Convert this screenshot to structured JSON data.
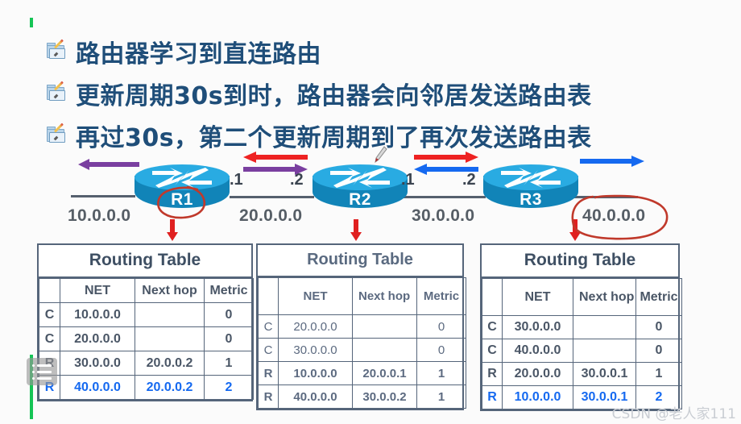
{
  "slide": {
    "bullets": [
      {
        "icon": "folder-pencil-icon",
        "text": "路由器学习到直连路由"
      },
      {
        "icon": "folder-pencil-icon",
        "text": "更新周期30s到时，路由器会向邻居发送路由表"
      },
      {
        "icon": "folder-pencil-icon",
        "text": "再过30s，第二个更新周期到了再次发送路由表"
      }
    ],
    "watermark": "CSDN @老人家111"
  },
  "diagram": {
    "routers": [
      {
        "name": "R1"
      },
      {
        "name": "R2"
      },
      {
        "name": "R3"
      }
    ],
    "networks": [
      {
        "label": "10.0.0.0"
      },
      {
        "label": "20.0.0.0"
      },
      {
        "label": "30.0.0.0"
      },
      {
        "label": "40.0.0.0"
      }
    ],
    "interfaces": [
      {
        "label": ".1"
      },
      {
        "label": ".2"
      },
      {
        "label": ".1"
      },
      {
        "label": ".2"
      }
    ],
    "arrow_colors": {
      "purple": "#7a3fa0",
      "red": "#ee2222",
      "blue": "#1569f0",
      "annotation_red": "#c0392b"
    }
  },
  "tables": [
    {
      "id": "rt1",
      "title": "Routing Table",
      "headers": [
        "",
        "NET",
        "Next hop",
        "Metric"
      ],
      "rows": [
        {
          "style": "normal",
          "cells": [
            "C",
            "10.0.0.0",
            "",
            "0"
          ]
        },
        {
          "style": "normal",
          "cells": [
            "C",
            "20.0.0.0",
            "",
            "0"
          ]
        },
        {
          "style": "normal",
          "cells": [
            "R",
            "30.0.0.0",
            "20.0.0.2",
            "1"
          ]
        },
        {
          "style": "highlight",
          "cells": [
            "R",
            "40.0.0.0",
            "20.0.0.2",
            "2"
          ]
        }
      ]
    },
    {
      "id": "rt2",
      "title": "Routing Table",
      "headers": [
        "",
        "NET",
        "Next hop",
        "Metric"
      ],
      "rows": [
        {
          "style": "dim",
          "cells": [
            "C",
            "20.0.0.0",
            "",
            "0"
          ]
        },
        {
          "style": "dim",
          "cells": [
            "C",
            "30.0.0.0",
            "",
            "0"
          ]
        },
        {
          "style": "normal",
          "cells": [
            "R",
            "10.0.0.0",
            "20.0.0.1",
            "1"
          ]
        },
        {
          "style": "normal",
          "cells": [
            "R",
            "40.0.0.0",
            "30.0.0.2",
            "1"
          ]
        }
      ]
    },
    {
      "id": "rt3",
      "title": "Routing Table",
      "headers": [
        "",
        "NET",
        "Next hop",
        "Metric"
      ],
      "rows": [
        {
          "style": "normal",
          "cells": [
            "C",
            "30.0.0.0",
            "",
            "0"
          ]
        },
        {
          "style": "normal",
          "cells": [
            "C",
            "40.0.0.0",
            "",
            "0"
          ]
        },
        {
          "style": "normal",
          "cells": [
            "R",
            "20.0.0.0",
            "30.0.0.1",
            "1"
          ]
        },
        {
          "style": "highlight",
          "cells": [
            "R",
            "10.0.0.0",
            "30.0.0.1",
            "2"
          ]
        }
      ]
    }
  ],
  "overlay": {
    "list_button": "list-menu-icon"
  }
}
